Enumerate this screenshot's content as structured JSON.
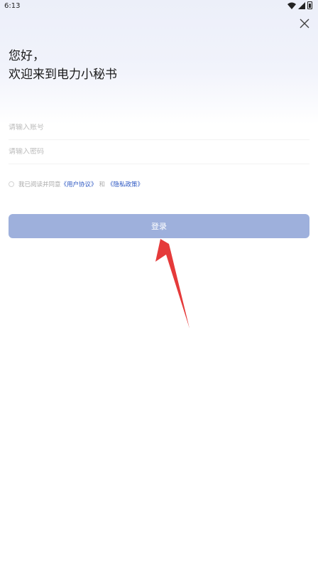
{
  "status_bar": {
    "time": "6:13"
  },
  "greeting": {
    "line1": "您好，",
    "line2": "欢迎来到电力小秘书"
  },
  "form": {
    "account_placeholder": "请输入账号",
    "password_placeholder": "请输入密码"
  },
  "agreement": {
    "prefix": "我已阅读并同意",
    "user_agreement": "《用户协议》",
    "and": "和",
    "privacy_policy": "《隐私政策》"
  },
  "login_button": {
    "label": "登录",
    "color": "#9eb0dc"
  },
  "annotation": {
    "arrow_color": "#e53a3a"
  }
}
